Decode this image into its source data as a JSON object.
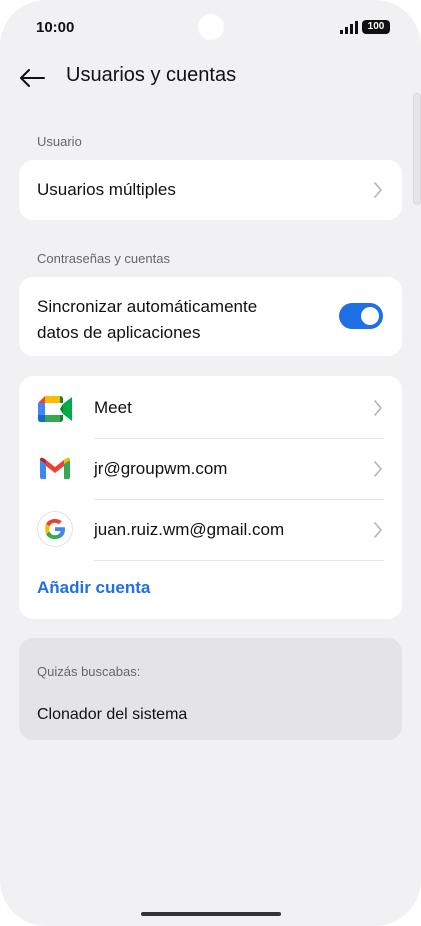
{
  "status": {
    "time": "10:00",
    "battery": "100"
  },
  "header": {
    "title": "Usuarios y cuentas"
  },
  "sections": {
    "users_label": "Usuario",
    "passwords_label": "Contraseñas y cuentas"
  },
  "users": {
    "multiple_users": "Usuarios múltiples"
  },
  "sync": {
    "line1": "Sincronizar automáticamente",
    "line2": "datos de aplicaciones",
    "enabled": true
  },
  "accounts": [
    {
      "label": "Meet",
      "icon": "google-meet-icon"
    },
    {
      "label": "jr@groupwm.com",
      "icon": "gmail-icon"
    },
    {
      "label": "juan.ruiz.wm@gmail.com",
      "icon": "google-icon"
    }
  ],
  "add_account": "Añadir cuenta",
  "suggestions": {
    "label": "Quizás buscabas:",
    "item": "Clonador del sistema"
  },
  "colors": {
    "accent": "#1f6fe5",
    "background": "#f1f1f3",
    "card": "#ffffff"
  }
}
